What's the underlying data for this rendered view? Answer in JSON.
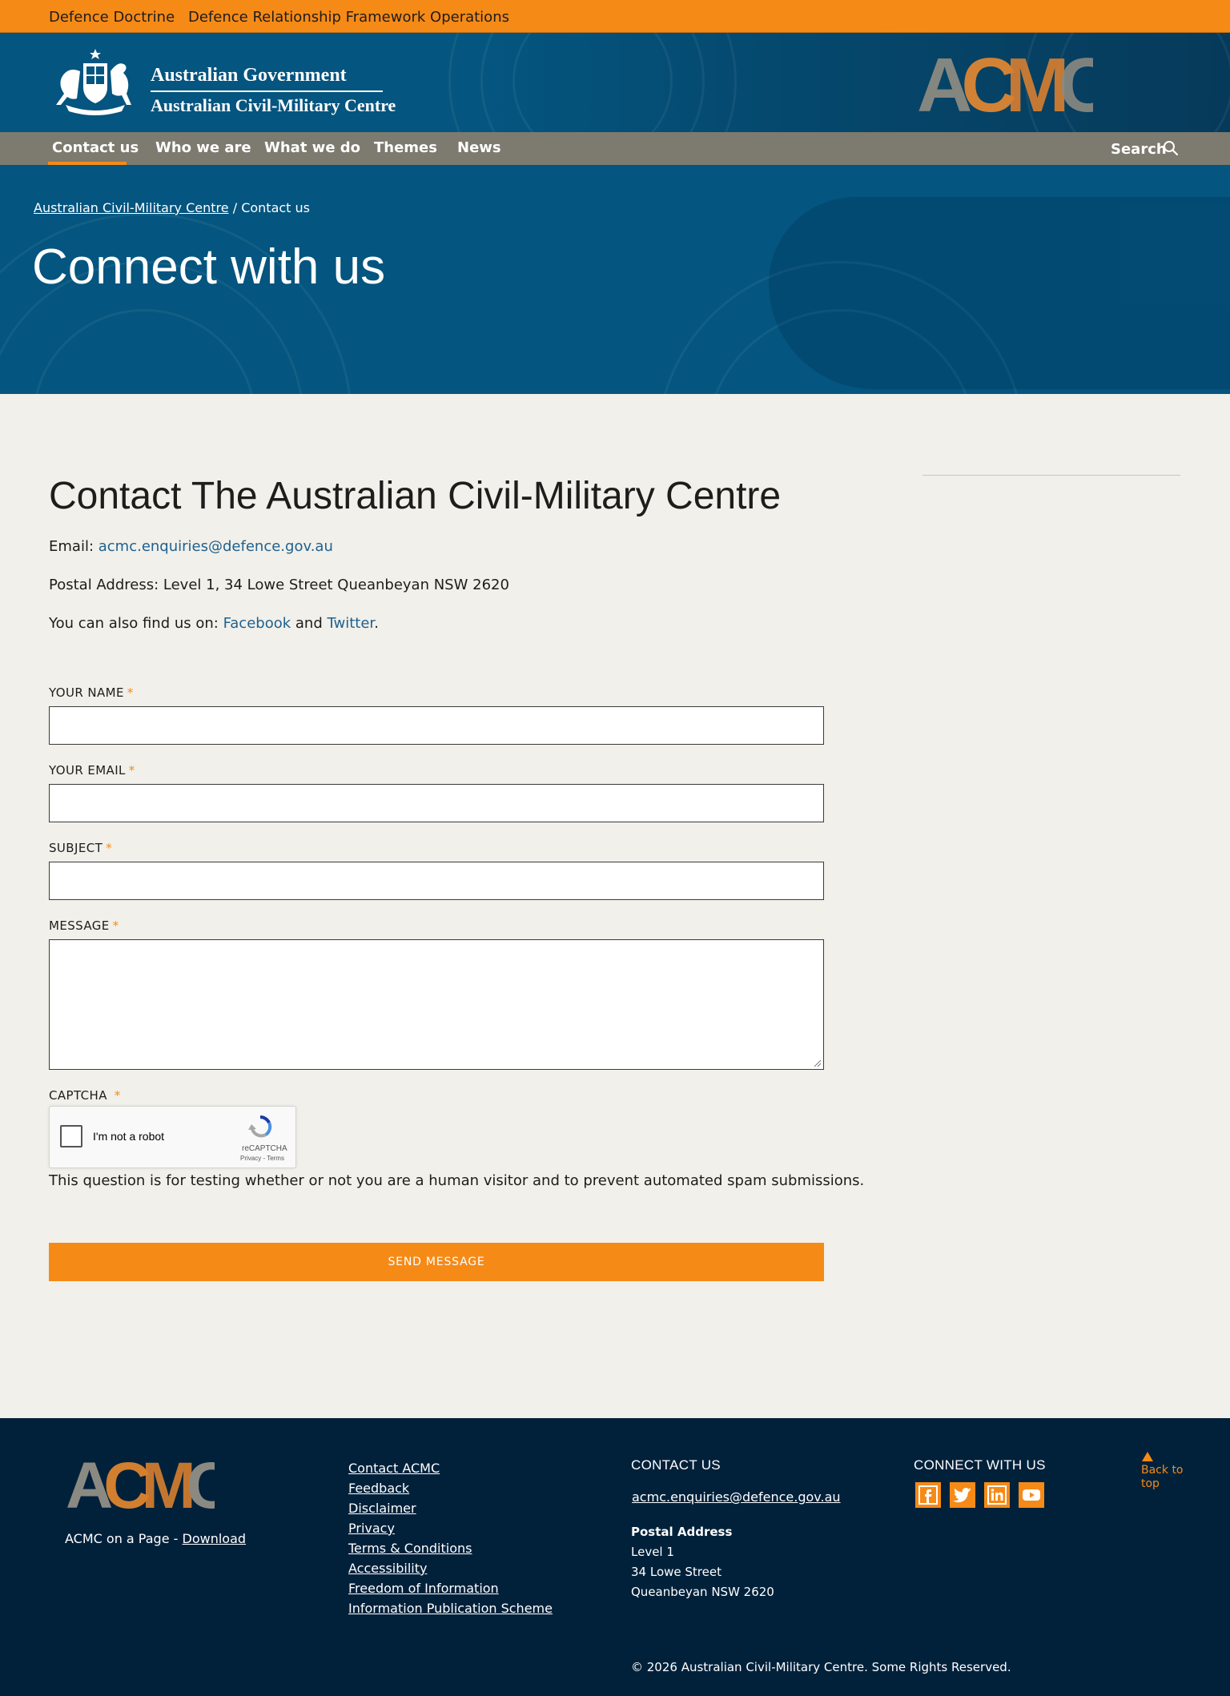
{
  "topbar": {
    "links": [
      "Defence Doctrine",
      "Defence Relationship Framework Operations"
    ]
  },
  "header": {
    "gov_line1": "Australian Government",
    "gov_line2": "Australian Civil-Military Centre",
    "logo_letters": "ACMC"
  },
  "nav": {
    "items": [
      "Contact us",
      "Who we are",
      "What we do",
      "Themes",
      "News"
    ],
    "active": "Contact us",
    "search_label": "Search"
  },
  "hero": {
    "breadcrumb_parent": "Australian Civil-Military Centre",
    "breadcrumb_sep": "/",
    "breadcrumb_current": "Contact us",
    "title": "Connect with us"
  },
  "contact": {
    "title": "Contact The Australian Civil-Military Centre",
    "email_label": "Email:",
    "email": "acmc.enquiries@defence.gov.au",
    "postal": "Postal Address: Level 1, 34 Lowe Street Queanbeyan NSW 2620",
    "find_prefix": "You can also find us on:",
    "facebook": "Facebook",
    "and": "and",
    "twitter": "Twitter",
    "period": "."
  },
  "form": {
    "name_label": "YOUR NAME",
    "email_label": "YOUR EMAIL",
    "subject_label": "SUBJECT",
    "message_label": "MESSAGE",
    "captcha_label": "CAPTCHA",
    "required_mark": "*",
    "name_value": "",
    "email_value": "",
    "subject_value": "",
    "message_value": "",
    "captcha_text": "I'm not a robot",
    "captcha_brand": "reCAPTCHA",
    "captcha_links": "Privacy - Terms",
    "help_text": "This question is for testing whether or not you are a human visitor and to prevent automated spam submissions.",
    "submit_label": "SEND MESSAGE"
  },
  "footer": {
    "on_page_label": "ACMC on a Page -",
    "download": "Download",
    "links": [
      "Contact ACMC",
      "Feedback",
      "Disclaimer",
      "Privacy",
      "Terms & Conditions",
      "Accessibility",
      "Freedom of Information",
      "Information Publication Scheme"
    ],
    "contact_heading": "CONTACT US",
    "email": "acmc.enquiries@defence.gov.au",
    "postal_title": "Postal Address",
    "postal_lines": [
      "Level 1",
      "34 Lowe Street",
      "Queanbeyan NSW 2620"
    ],
    "connect_heading": "CONNECT WITH US",
    "social": [
      "facebook-icon",
      "twitter-icon",
      "linkedin-icon",
      "youtube-icon"
    ],
    "back_to_top": "Back to top",
    "copyright": "© 2026 Australian Civil-Military Centre. Some Rights Reserved."
  },
  "colors": {
    "orange": "#f68a17",
    "blue": "#04557f",
    "navy": "#01213b",
    "grey_nav": "#7d7a6f",
    "link": "#1f6190",
    "page_bg": "#f1f0ea"
  }
}
